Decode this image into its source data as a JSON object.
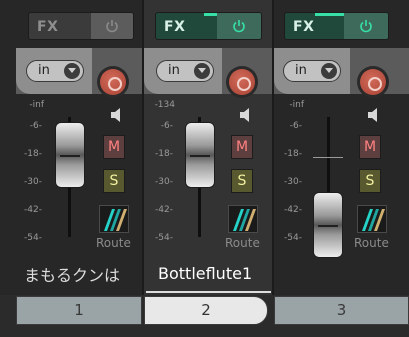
{
  "strips": [
    {
      "fx_label": "FX",
      "fx_state": "off",
      "input_label": "in",
      "scale": [
        "-inf",
        "-6-",
        "-18-",
        "-30-",
        "-42-",
        "-54-"
      ],
      "mute_label": "M",
      "solo_label": "S",
      "route_label": "Route",
      "name": "まもるクンは",
      "number": "1"
    },
    {
      "fx_label": "FX",
      "fx_state": "on",
      "input_label": "in",
      "scale": [
        "-134",
        "-6-",
        "-18-",
        "-30-",
        "-42-",
        "-54-"
      ],
      "mute_label": "M",
      "solo_label": "S",
      "route_label": "Route",
      "name": "Bottleflute1",
      "number": "2",
      "selected": true
    },
    {
      "fx_label": "FX",
      "fx_state": "on",
      "input_label": "in",
      "scale": [
        "-inf",
        "-6-",
        "-18-",
        "-30-",
        "-42-",
        "-54-"
      ],
      "mute_label": "M",
      "solo_label": "S",
      "route_label": "Route",
      "name": "",
      "number": "3"
    }
  ],
  "colors": {
    "fx_active": "#37e0a6",
    "record": "#b04a3a",
    "mute_text": "#ff8080",
    "solo_text": "#f0f0a0",
    "route_accent": "#24d4c8"
  },
  "icons": [
    "power-icon",
    "chevron-down-icon",
    "record-arm-icon",
    "speaker-icon",
    "route-icon"
  ]
}
